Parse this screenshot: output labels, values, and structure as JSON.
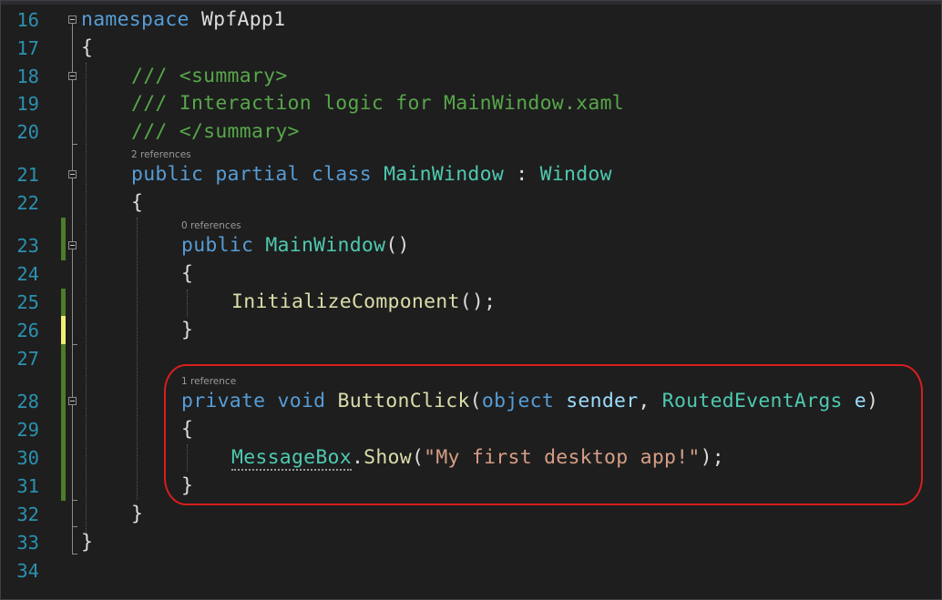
{
  "editor": {
    "line_numbers": [
      "16",
      "17",
      "18",
      "19",
      "20",
      "21",
      "22",
      "23",
      "24",
      "25",
      "26",
      "27",
      "28",
      "29",
      "30",
      "31",
      "32",
      "33",
      "34"
    ],
    "codelens": {
      "class_refs": "2 references",
      "ctor_refs": "0 references",
      "method_refs": "1 reference"
    },
    "lines": {
      "l16_kw": "namespace",
      "l16_name": " WpfApp1",
      "l17": "{",
      "l18": "/// <summary>",
      "l19": "/// Interaction logic for MainWindow.xaml",
      "l20": "/// </summary>",
      "l21_kw": "public partial class ",
      "l21_type": "MainWindow",
      "l21_colon": " : ",
      "l21_base": "Window",
      "l22": "{",
      "l23_kw": "public ",
      "l23_name": "MainWindow",
      "l23_parens": "()",
      "l24": "{",
      "l25_call": "InitializeComponent",
      "l25_rest": "();",
      "l26": "}",
      "l28_kw": "private void ",
      "l28_name": "ButtonClick",
      "l28_open": "(",
      "l28_ptype": "object",
      "l28_pname": " sender",
      "l28_comma": ", ",
      "l28_ptype2": "RoutedEventArgs",
      "l28_pname2": " e",
      "l28_close": ")",
      "l29": "{",
      "l30_type": "MessageBox",
      "l30_dot": ".",
      "l30_call": "Show",
      "l30_open": "(",
      "l30_str": "\"My first desktop app!\"",
      "l30_close": ");",
      "l31": "}",
      "l32": "}",
      "l33": "}"
    }
  },
  "colors": {
    "background": "#1e1e1e",
    "line_number": "#2b91af",
    "keyword": "#569cd6",
    "type": "#4ec9b0",
    "method": "#dcdcaa",
    "comment": "#57a64a",
    "string": "#d69d85",
    "parameter": "#9cdcfe",
    "highlight_box": "#d81e1e",
    "change_saved": "#4d7c2b",
    "change_unsaved": "#efef71"
  }
}
